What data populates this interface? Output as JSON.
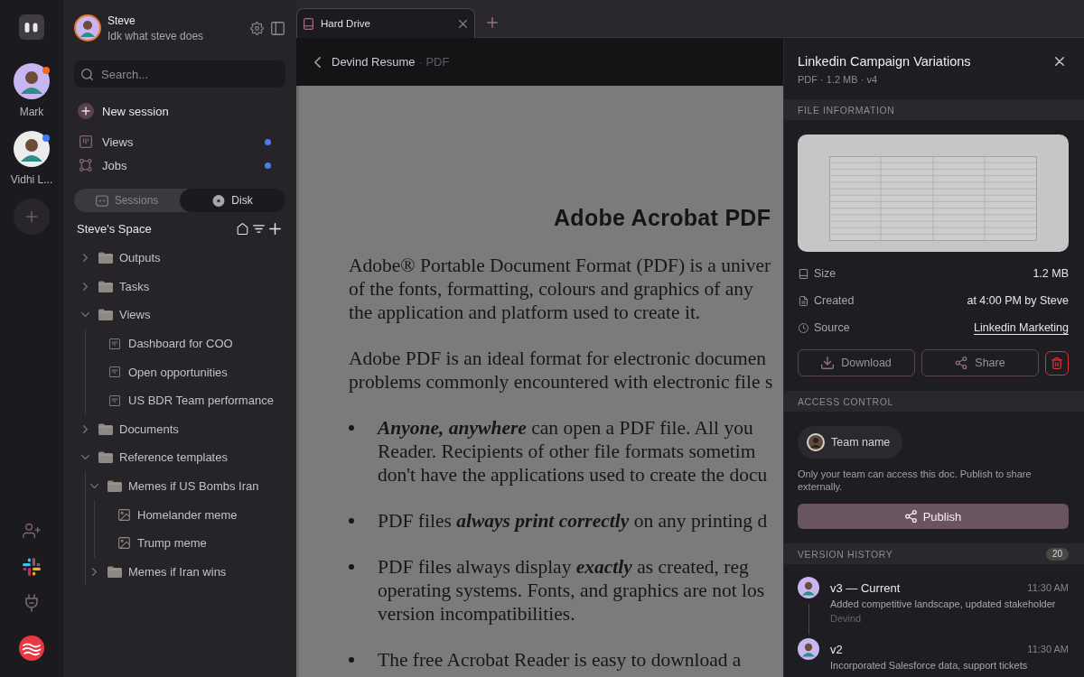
{
  "rail": {
    "users": [
      {
        "name": "Mark",
        "color": "#f26b1d"
      },
      {
        "name": "Vidhi L...",
        "color": "#3f7cf4"
      }
    ]
  },
  "sidebar": {
    "profile": {
      "name": "Steve",
      "subtitle": "Idk what steve does"
    },
    "search": {
      "placeholder": "Search..."
    },
    "new_session": "New session",
    "nav": [
      {
        "label": "Views",
        "kind": "views",
        "unread": true
      },
      {
        "label": "Jobs",
        "kind": "jobs",
        "unread": true
      }
    ],
    "segments": [
      {
        "label": "Sessions",
        "kind": "sessions",
        "selected": false
      },
      {
        "label": "Disk",
        "kind": "disk",
        "selected": true
      }
    ],
    "space_title": "Steve's Space",
    "tree": [
      {
        "label": "Outputs",
        "kind": "folder",
        "expanded": false
      },
      {
        "label": "Tasks",
        "kind": "folder",
        "expanded": false
      },
      {
        "label": "Views",
        "kind": "folder",
        "expanded": true,
        "children": [
          {
            "label": "Dashboard for COO",
            "kind": "view"
          },
          {
            "label": "Open opportunities",
            "kind": "view"
          },
          {
            "label": "US BDR Team performance",
            "kind": "view"
          }
        ]
      },
      {
        "label": "Documents",
        "kind": "folder",
        "expanded": false
      },
      {
        "label": "Reference templates",
        "kind": "folder",
        "expanded": true,
        "children": [
          {
            "label": "Memes if US Bombs Iran",
            "kind": "folder",
            "expanded": true,
            "children": [
              {
                "label": "Homelander meme",
                "kind": "image"
              },
              {
                "label": "Trump meme",
                "kind": "image"
              }
            ]
          },
          {
            "label": "Memes if Iran wins",
            "kind": "folder",
            "expanded": false
          }
        ]
      }
    ]
  },
  "tabs": [
    {
      "label": "Hard Drive",
      "selected": true
    }
  ],
  "document": {
    "title": "Devind Resume",
    "suffix": "· PDF",
    "heading": "Adobe Acrobat PDF",
    "blocks": [
      {
        "kind": "paragraph",
        "lines": [
          "Adobe® Portable Document Format (PDF) is a univer",
          "of the fonts, formatting, colours and graphics of any",
          "the application and platform used to create it."
        ]
      },
      {
        "kind": "paragraph",
        "lines": [
          "Adobe PDF is an ideal format for electronic documen",
          "problems commonly encountered with electronic file s"
        ]
      },
      {
        "kind": "bullet",
        "lines": [
          "*Anyone, anywhere* can open a PDF file. All you",
          "Reader. Recipients of other file formats sometim",
          "don't have the applications used to create the docu"
        ]
      },
      {
        "kind": "bullet",
        "lines": [
          "PDF files *always print correctly* on any printing d"
        ]
      },
      {
        "kind": "bullet",
        "lines": [
          "PDF files always display *exactly* as created, reg",
          "operating systems. Fonts, and graphics are not los",
          "version incompatibilities."
        ]
      },
      {
        "kind": "bullet",
        "lines": [
          "The free Acrobat Reader is easy to download a"
        ]
      }
    ]
  },
  "panel": {
    "title": "Linkedin Campaign Variations",
    "meta": "PDF · 1.2 MB · v4",
    "file_info": {
      "heading": "FILE INFORMATION",
      "properties": [
        {
          "kind": "size",
          "label": "Size",
          "value": "1.2 MB",
          "link": false
        },
        {
          "kind": "created",
          "label": "Created",
          "value": "at 4:00 PM by Steve",
          "link": false
        },
        {
          "kind": "source",
          "label": "Source",
          "value": "Linkedin Marketing",
          "link": true
        }
      ],
      "actions": [
        {
          "kind": "download",
          "label": "Download"
        },
        {
          "kind": "share",
          "label": "Share"
        },
        {
          "kind": "delete"
        }
      ]
    },
    "access": {
      "heading": "ACCESS CONTROL",
      "team": "Team name",
      "note": "Only your team can access this doc. Publish to share externally.",
      "publish": "Publish"
    },
    "versions": {
      "heading": "VERSION HISTORY",
      "count": "20",
      "items": [
        {
          "title": "v3 — Current",
          "time": "11:30 AM",
          "description": "Added competitive landscape, updated stakeholder",
          "author": "Devind"
        },
        {
          "title": "v2",
          "time": "11:30 AM",
          "description": "Incorporated Salesforce data, support tickets"
        }
      ]
    }
  }
}
